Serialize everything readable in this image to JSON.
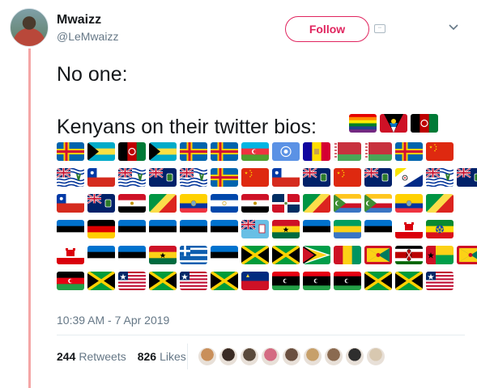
{
  "user": {
    "name": "Mwaizz",
    "handle": "@LeMwaizz"
  },
  "header": {
    "follow_label": "Follow",
    "bot_icon_text": "▫▫"
  },
  "tweet": {
    "line1": "No one:",
    "line2": "Kenyans on their twitter bios:",
    "title_flags": [
      "rainbow",
      "antigua",
      "afghanistan"
    ],
    "flag_rows": [
      [
        "aland",
        "bahamas",
        "afghanistan",
        "bahamas",
        "aland",
        "aland",
        "azerbaijan",
        "un",
        "andorra",
        "belarus",
        "belarus",
        "aland",
        "china"
      ],
      [
        "bit",
        "chile",
        "bit",
        "bvi",
        "bit",
        "aland",
        "china",
        "chile",
        "bvi",
        "china",
        "bvi",
        "bonaire",
        "bit",
        "bvi"
      ],
      [
        "chile",
        "bvi",
        "egypt",
        "congo",
        "ecuador",
        "el_salvador",
        "egypt",
        "dominican",
        "congo",
        "comoros",
        "comoros",
        "ecuador",
        "congo"
      ],
      [
        "estonia",
        "germany",
        "estonia",
        "estonia",
        "estonia",
        "estonia",
        "fiji",
        "ghana",
        "estonia",
        "gabon",
        "estonia",
        "gibraltar",
        "ethiopia"
      ],
      [
        "gibraltar",
        "estonia",
        "estonia",
        "ghana",
        "greece",
        "estonia",
        "jamaica",
        "jamaica",
        "guyana",
        "guinea",
        "grenada",
        "kenya",
        "guinea_bissau",
        "grenada"
      ],
      [
        "cuba_stub",
        "jamaica",
        "liberia",
        "jamaica",
        "liberia",
        "jamaica",
        "liechtenstein",
        "libya",
        "libya",
        "libya",
        "jamaica",
        "jamaica",
        "liberia"
      ]
    ],
    "timestamp": "10:39 AM - 7 Apr 2019"
  },
  "stats": {
    "retweets_count": "244",
    "retweets_label": "Retweets",
    "likes_count": "826",
    "likes_label": "Likes"
  },
  "likers": [
    "#c98f5a",
    "#3a2b24",
    "#5a4a3c",
    "#d46b82",
    "#6b5040",
    "#c7a06a",
    "#8a6a50",
    "#2e2e2e",
    "#d8c8b0"
  ],
  "colors": {
    "accent": "#e0245e",
    "thread": "#f4a6a6",
    "muted": "#657786"
  }
}
